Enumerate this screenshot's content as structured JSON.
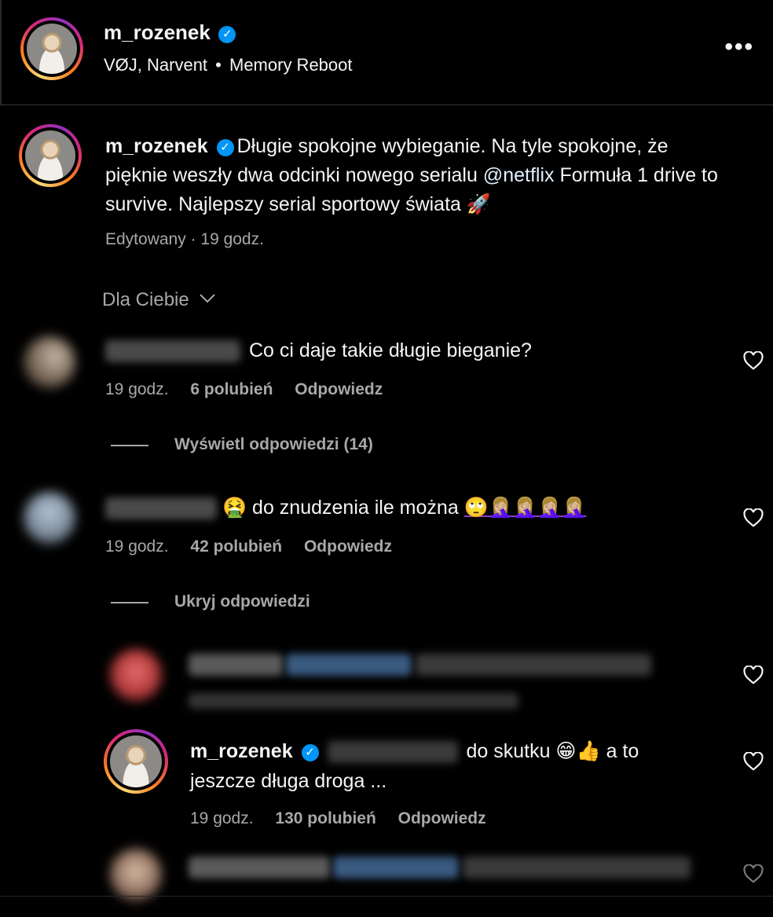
{
  "header": {
    "username": "m_rozenek",
    "audio": "VØJ, Narvent",
    "audio_sep": "•",
    "audio_title": "Memory Reboot",
    "more_label": "•••"
  },
  "caption": {
    "username": "m_rozenek",
    "text_before": "Długie spokojne wybieganie. Na tyle spokojne, że pięknie weszły dwa odcinki nowego serialu ",
    "mention": "@netflix",
    "text_after": " Formuła 1 drive to survive. Najlepszy serial sportowy świata 🚀",
    "meta": "Edytowany · 19 godz."
  },
  "sort": {
    "label": "Dla Ciebie"
  },
  "comments": [
    {
      "text": "Co ci daje takie długie bieganie?",
      "time": "19 godz.",
      "likes": "6 polubień",
      "reply": "Odpowiedz",
      "toggle": "Wyświetl odpowiedzi (14)"
    },
    {
      "emoji_lead": "🤮",
      "text": "do znudzenia ile można",
      "emoji_tail": "🙄🤦🏼‍♀️🤦🏼‍♀️🤦🏼‍♀️🤦🏼‍♀️",
      "time": "19 godz.",
      "likes": "42 polubień",
      "reply": "Odpowiedz",
      "toggle": "Ukryj odpowiedzi"
    }
  ],
  "reply_owner": {
    "username": "m_rozenek",
    "text_a": "do skutku 😁👍 a to",
    "text_b": "jeszcze długa droga ...",
    "time": "19 godz.",
    "likes": "130 polubień",
    "reply": "Odpowiedz"
  },
  "colors": {
    "verified": "#0095f6",
    "mention": "#e0f1ff",
    "muted": "#a8a8a8",
    "background": "#000000"
  }
}
